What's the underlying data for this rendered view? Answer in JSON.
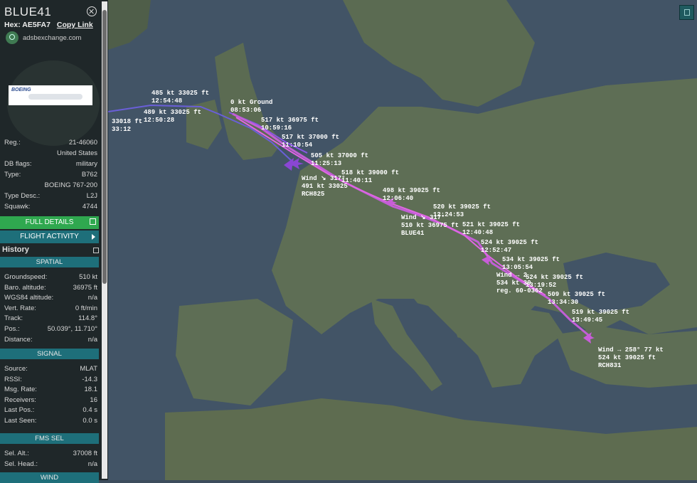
{
  "aircraft": {
    "callsign": "BLUE41",
    "hex_label": "Hex:",
    "hex": "AE5FA7",
    "copy_link": "Copy Link",
    "site": "adsbexchange.com",
    "photo_brand": "BOEING"
  },
  "info": [
    {
      "k": "Reg.:",
      "v": "21-46060"
    },
    {
      "k": "",
      "v": "United States"
    },
    {
      "k": "DB flags:",
      "v": "military"
    },
    {
      "k": "Type:",
      "v": "B762"
    },
    {
      "k": "",
      "v": "BOEING 767-200"
    },
    {
      "k": "Type Desc.:",
      "v": "L2J"
    },
    {
      "k": "Squawk:",
      "v": "4744"
    }
  ],
  "buttons": {
    "full_details": "FULL DETAILS",
    "flight_activity": "FLIGHT ACTIVITY",
    "history": "History"
  },
  "spatial": {
    "title": "SPATIAL",
    "rows": [
      {
        "k": "Groundspeed:",
        "v": "510 kt"
      },
      {
        "k": "Baro. altitude:",
        "v": "36975 ft"
      },
      {
        "k": "WGS84 altitude:",
        "v": "n/a"
      },
      {
        "k": "Vert. Rate:",
        "v": "0 ft/min"
      },
      {
        "k": "Track:",
        "v": "114.8°"
      },
      {
        "k": "Pos.:",
        "v": "50.039°, 11.710°"
      },
      {
        "k": "Distance:",
        "v": "n/a"
      }
    ]
  },
  "signal": {
    "title": "SIGNAL",
    "rows": [
      {
        "k": "Source:",
        "v": "MLAT"
      },
      {
        "k": "RSSI:",
        "v": "-14.3"
      },
      {
        "k": "Msg. Rate:",
        "v": "18.1"
      },
      {
        "k": "Receivers:",
        "v": "16"
      },
      {
        "k": "Last Pos.:",
        "v": "0.4 s"
      },
      {
        "k": "Last Seen:",
        "v": "0.0 s"
      }
    ]
  },
  "fms": {
    "title": "FMS SEL",
    "rows": [
      {
        "k": "Sel. Alt.:",
        "v": "37008 ft"
      },
      {
        "k": "Sel. Head.:",
        "v": "n/a"
      }
    ]
  },
  "wind": {
    "title": "WIND"
  },
  "map_labels": {
    "l1a": "485 kt  33025 ft",
    "l1b": "12:54:48",
    "l2a": "489 kt  33025 ft",
    "l2b": "12:50:28",
    "l3a": "33018 ft",
    "l3b": "33:12",
    "l4a": "0 kt  Ground",
    "l4b": "08:53:06",
    "l5a": "517 kt  36975 ft",
    "l5b": "10:59:16",
    "l6a": "517 kt  37000 ft",
    "l6b": "11:10:54",
    "l7a": "505 kt  37000 ft",
    "l7b": "11:25:13",
    "l8a": "518 kt  39000 ft",
    "l8b": "11:40:11",
    "w1a": "Wind ↘ 317°",
    "w1b": "491 kt  33025",
    "w1c": "RCH825",
    "l9a": "498 kt  39025 ft",
    "l9b": "12:06:40",
    "w2a": "Wind ↘ 317°",
    "w2b": "510 kt  36975 ft",
    "w2c": "BLUE41",
    "l10a": "520 kt  39025 ft",
    "l10b": "12:24:53",
    "l11a": "521 kt  39025 ft",
    "l11b": "12:40:48",
    "l12a": "524 kt  39025 ft",
    "l12b": "12:52:47",
    "l13a": "534 kt  39025 ft",
    "l13b": "13:05:54",
    "w3a": "Wind → 2",
    "w3b": "534 kt  39",
    "w3c": "reg. 60-0362",
    "l14a": "524 kt  39025 ft",
    "l14b": "13:19:52",
    "l15a": "509 kt  39025 ft",
    "l15b": "13:34:30",
    "l16a": "519 kt  39025 ft",
    "l16b": "13:49:45",
    "w4a": "Wind → 258° 77 kt",
    "w4b": "524 kt  39025 ft",
    "w4c": "RCH831"
  }
}
